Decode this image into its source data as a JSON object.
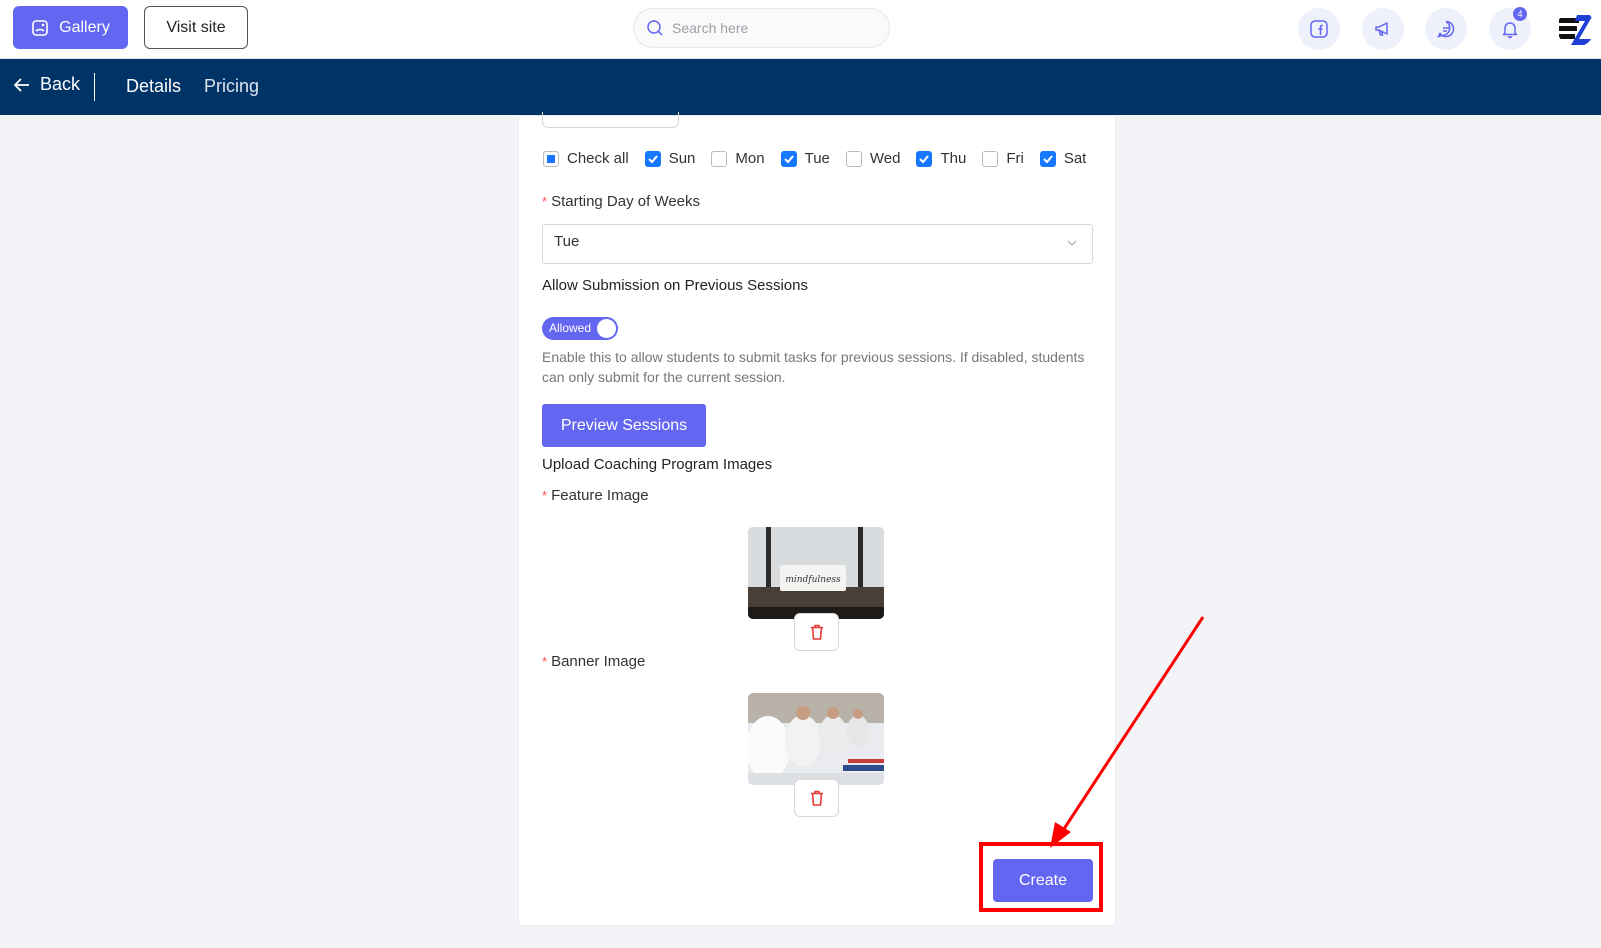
{
  "topbar": {
    "gallery_label": "Gallery",
    "visit_label": "Visit site",
    "search_placeholder": "Search here",
    "notification_count": "4"
  },
  "navbar": {
    "back_label": "Back",
    "tabs": [
      "Details",
      "Pricing"
    ]
  },
  "form": {
    "days": [
      {
        "label": "Check all",
        "state": "indeterminate"
      },
      {
        "label": "Sun",
        "state": "checked"
      },
      {
        "label": "Mon",
        "state": "unchecked"
      },
      {
        "label": "Tue",
        "state": "checked"
      },
      {
        "label": "Wed",
        "state": "unchecked"
      },
      {
        "label": "Thu",
        "state": "checked"
      },
      {
        "label": "Fri",
        "state": "unchecked"
      },
      {
        "label": "Sat",
        "state": "checked"
      }
    ],
    "starting_day_label": "Starting Day of Weeks",
    "starting_day_value": "Tue",
    "allow_submission_title": "Allow Submission on Previous Sessions",
    "toggle_label": "Allowed",
    "help_text": "Enable this to allow students to submit tasks for previous sessions. If disabled, students can only submit for the current session.",
    "preview_button": "Preview Sessions",
    "upload_title": "Upload Coaching Program Images",
    "feature_image_label": "Feature Image",
    "banner_image_label": "Banner Image",
    "feature_image_text": "mindfulness",
    "create_button": "Create",
    "required_mark": "*"
  },
  "colors": {
    "primary": "#6366f1",
    "navbar": "#003366",
    "checkbox": "#1677ff",
    "annotation": "#ff0000",
    "delete": "#e53935"
  }
}
